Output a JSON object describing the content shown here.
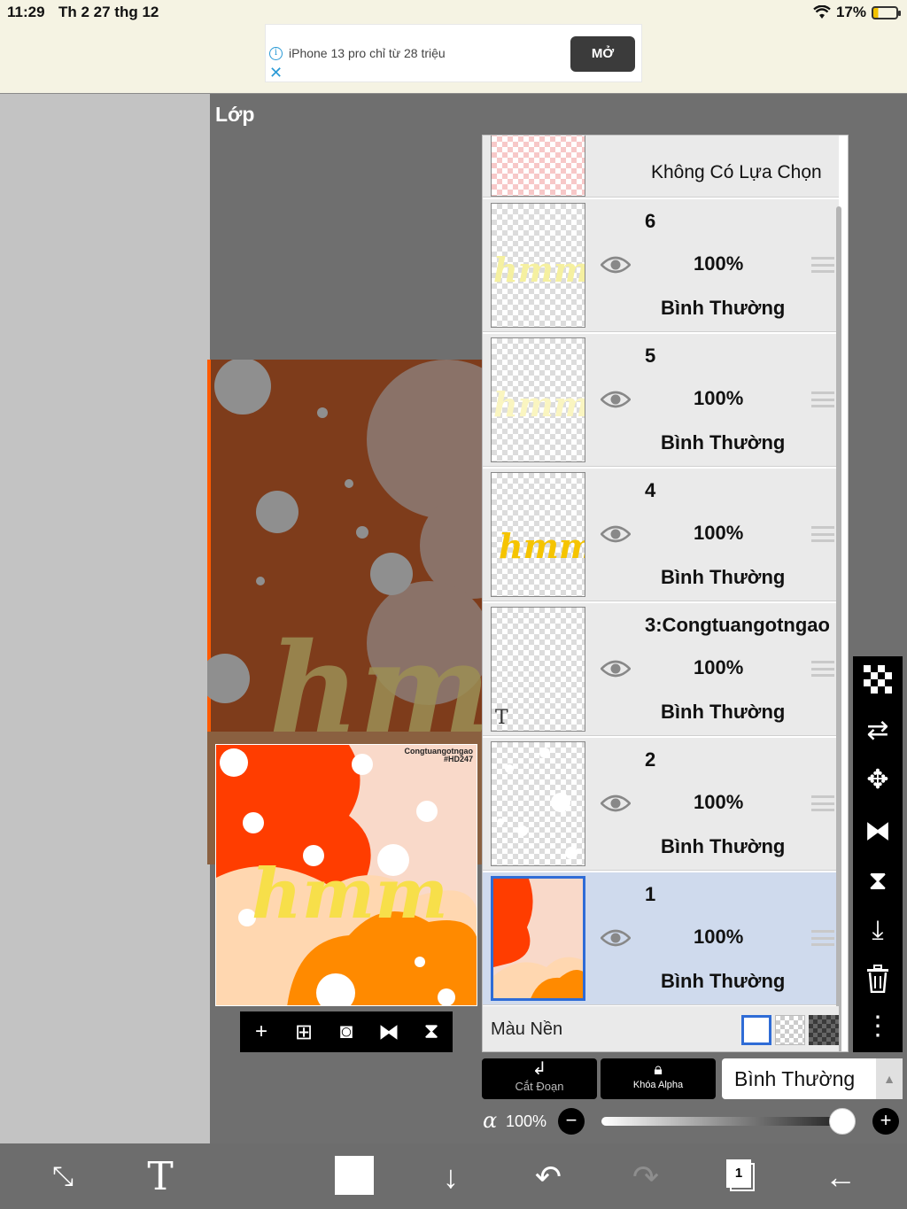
{
  "status": {
    "time": "11:29",
    "date": "Th 2 27 thg 12",
    "battery": "17%"
  },
  "ad": {
    "text": "iPhone 13 pro chỉ từ 28 triệu",
    "button": "MỞ"
  },
  "panel": {
    "title": "Lớp"
  },
  "canvas": {
    "signature_line1": "Congtuangotngao",
    "signature_line2": "#HD247",
    "handwriting": "hmm"
  },
  "layers": {
    "selection": {
      "label": "Không Có Lựa Chọn"
    },
    "items": [
      {
        "name": "6",
        "opacity": "100%",
        "blend": "Bình Thường"
      },
      {
        "name": "5",
        "opacity": "100%",
        "blend": "Bình Thường"
      },
      {
        "name": "4",
        "opacity": "100%",
        "blend": "Bình Thường"
      },
      {
        "name": "3:Congtuangotngao",
        "opacity": "100%",
        "blend": "Bình Thường",
        "text_marker": "T"
      },
      {
        "name": "2",
        "opacity": "100%",
        "blend": "Bình Thường"
      },
      {
        "name": "1",
        "opacity": "100%",
        "blend": "Bình Thường",
        "selected": true
      }
    ],
    "background_label": "Màu Nền"
  },
  "bottom_controls": {
    "clip_label": "Cắt Đoạn",
    "alpha_lock_label": "Khóa Alpha",
    "blend_mode": "Bình Thường",
    "alpha_symbol": "α",
    "alpha_value": "100%",
    "alpha_level": 1.0
  },
  "icons": {
    "layer_toolbar": [
      "plus-icon",
      "add-layer-icon",
      "camera-icon",
      "flip-horizontal-icon",
      "flip-vertical-icon"
    ],
    "right_toolbar": [
      "checker-icon",
      "reference-icon",
      "move-icon",
      "flip-h-icon",
      "flip-v-icon",
      "merge-down-icon",
      "trash-icon",
      "more-icon"
    ],
    "bottom_toolbar": [
      "transform-icon",
      "text-icon",
      "color-swatch",
      "down-arrow-icon",
      "undo-icon",
      "redo-icon",
      "layers-icon",
      "back-icon"
    ]
  },
  "layer_count_badge": "1",
  "colors": {
    "accent": "#2f6cd6",
    "orange": "#ff7a00",
    "red_orange": "#ff3d00",
    "peach": "#f9d9c9",
    "yellow": "#f7df4a"
  }
}
